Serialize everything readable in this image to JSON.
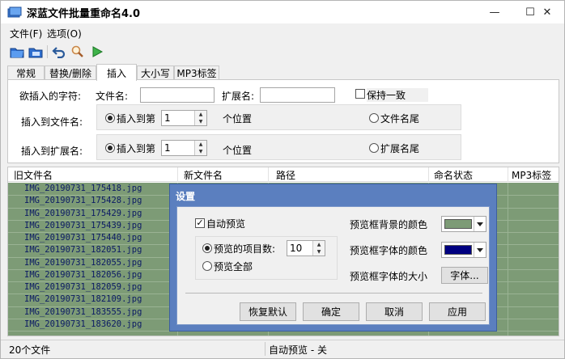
{
  "window": {
    "title": "深蓝文件批量重命名4.0"
  },
  "titlebar": {
    "minimize": "—",
    "maximize": "☐",
    "close": "✕"
  },
  "menu": {
    "file": "文件(F)",
    "options": "选项(O)"
  },
  "tabs": [
    "常规",
    "替换/删除",
    "插入",
    "大小写",
    "MP3标签"
  ],
  "insert_panel": {
    "chars_label": "欲插入的字符:",
    "filename_label": "文件名:",
    "ext_label": "扩展名:",
    "keep_same": "保持一致",
    "to_filename_label": "插入到文件名:",
    "to_ext_label": "插入到扩展名:",
    "insert_at": "插入到第",
    "filename_pos_value": "1",
    "ext_pos_value": "1",
    "position_unit": "个位置",
    "filename_end": "文件名尾",
    "ext_end": "扩展名尾"
  },
  "list": {
    "columns": [
      "旧文件名",
      "新文件名",
      "路径",
      "命名状态",
      "MP3标签"
    ],
    "files": [
      "IMG_20190731_175418.jpg",
      "IMG_20190731_175428.jpg",
      "IMG_20190731_175429.jpg",
      "IMG_20190731_175439.jpg",
      "IMG_20190731_175440.jpg",
      "IMG_20190731_182051.jpg",
      "IMG_20190731_182055.jpg",
      "IMG_20190731_182056.jpg",
      "IMG_20190731_182059.jpg",
      "IMG_20190731_182109.jpg",
      "IMG_20190731_183555.jpg",
      "IMG_20190731_183620.jpg"
    ],
    "hidden_partial_text": "****"
  },
  "status": {
    "count": "20个文件",
    "preview": "自动预览 - 关"
  },
  "dialog": {
    "title": "设置",
    "auto_preview": "自动预览",
    "preview_count_label": "预览的项目数:",
    "preview_count_value": "10",
    "preview_all": "预览全部",
    "bg_color_label": "预览框背景的颜色",
    "font_color_label": "预览框字体的颜色",
    "font_size_label": "预览框字体的大小",
    "font_button": "字体...",
    "restore_default": "恢复默认",
    "ok": "确定",
    "cancel": "取消",
    "apply": "应用"
  },
  "colors": {
    "preview_bg": "#7d9b76",
    "preview_font": "#000080",
    "dialog_frame": "#5b7fbf"
  },
  "icons": [
    "app-icon",
    "open-file-icon",
    "open-folder-icon",
    "undo-icon",
    "search-icon",
    "run-icon"
  ]
}
